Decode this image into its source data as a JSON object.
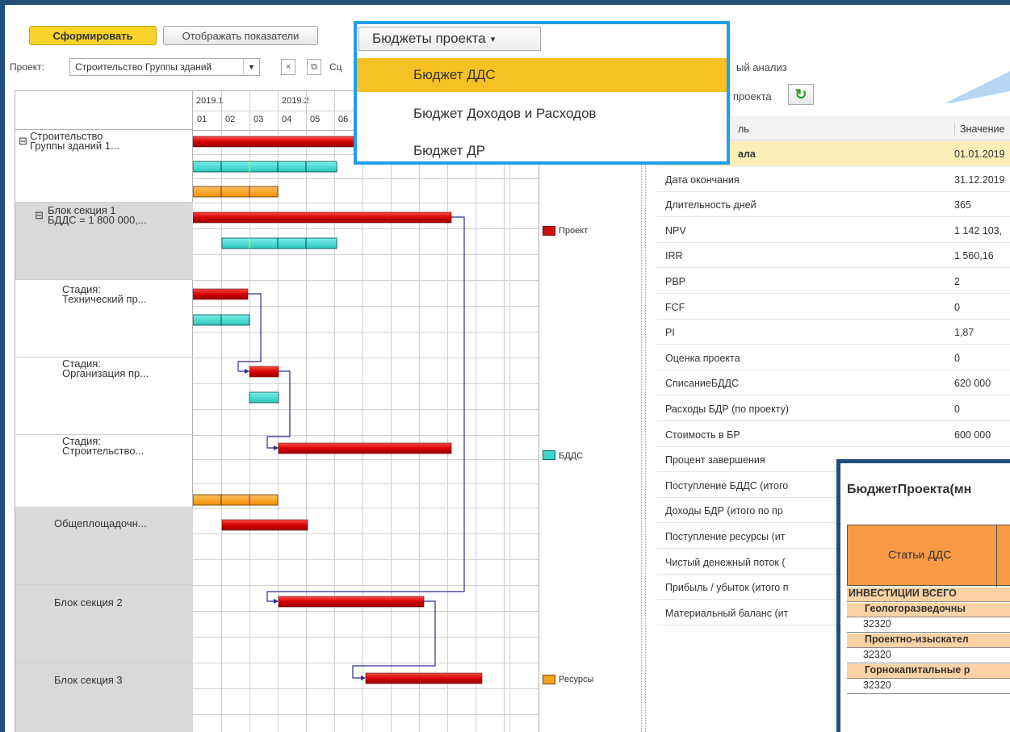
{
  "toolbar": {
    "form_label": "Сформировать",
    "show_label": "Отображать показатели"
  },
  "filter": {
    "project_label": "Проект:",
    "project_value": "Строительство Группы зданий",
    "clear_symbol": "×",
    "open_symbol": "⧉",
    "extra_label": "Сц"
  },
  "dropdown": {
    "title": "Бюджеты проекта",
    "items": [
      "Бюджет ДДС",
      "Бюджет Доходов и Расходов",
      "Бюджет ДР"
    ],
    "selected_index": 0
  },
  "gantt": {
    "periods": [
      {
        "label": "2019.1"
      },
      {
        "label": "2019.2"
      }
    ],
    "months": [
      "01",
      "02",
      "03",
      "04",
      "05",
      "06"
    ],
    "rows": [
      {
        "text": "Строительство\nГруппы зданий 1...",
        "toggle": "⊟"
      },
      {
        "text": "Блок секция 1\nБДДС = 1 800 000,...",
        "toggle": "⊟"
      },
      {
        "text": "Стадия:\nТехнический пр..."
      },
      {
        "text": "Стадия:\nОрганизация пр..."
      },
      {
        "text": "Стадия:\nСтроительство..."
      },
      {
        "text": "Общеплощадочн..."
      },
      {
        "text": "Блок секция 2"
      },
      {
        "text": "Блок секция 3"
      }
    ],
    "legend": [
      {
        "label": "Проект",
        "color": "#cc1111"
      },
      {
        "label": "БДДС",
        "color": "#3dd6cf"
      },
      {
        "label": "Ресурсы",
        "color": "#f5a31a"
      }
    ]
  },
  "right_panel": {
    "analysis_label": "ый анализ",
    "project_caption": "проекта",
    "refresh_icon": "refresh-icon",
    "col_name": "ль",
    "col_value": "Значение",
    "rows": [
      {
        "name": "ала",
        "value": "01.01.2019"
      },
      {
        "name": "Дата окончания",
        "value": "31.12.2019"
      },
      {
        "name": "Длительность дней",
        "value": "365"
      },
      {
        "name": "NPV",
        "value": "1 142 103,"
      },
      {
        "name": "IRR",
        "value": "1 560,16"
      },
      {
        "name": "PBP",
        "value": "2"
      },
      {
        "name": "FCF",
        "value": "0"
      },
      {
        "name": "PI",
        "value": "1,87"
      },
      {
        "name": "Оценка проекта",
        "value": "0"
      },
      {
        "name": "СписаниеБДДС",
        "value": "620 000"
      },
      {
        "name": "Расходы БДР (по проекту)",
        "value": "0"
      },
      {
        "name": "Стоимость в БР",
        "value": "600 000"
      },
      {
        "name": "Процент завершения",
        "value": ""
      },
      {
        "name": "Поступление БДДС (итого",
        "value": ""
      },
      {
        "name": "Доходы БДР (итого по пр",
        "value": ""
      },
      {
        "name": "Поступление ресурсы (ит",
        "value": ""
      },
      {
        "name": "Чистый денежный поток (",
        "value": ""
      },
      {
        "name": "Прибыль / убыток (итого п",
        "value": ""
      },
      {
        "name": "Материальный баланс (ит",
        "value": ""
      }
    ]
  },
  "budget": {
    "title": "БюджетПроекта(мн",
    "header": "Статьи ДДС",
    "rows": [
      {
        "text": "ИНВЕСТИЦИИ ВСЕГО",
        "style": "o"
      },
      {
        "text": "Геологоразведочны",
        "style": "o"
      },
      {
        "text": "32320",
        "style": "w"
      },
      {
        "text": "Проектно-изыскател",
        "style": "o"
      },
      {
        "text": "32320",
        "style": "w"
      },
      {
        "text": "Горнокапитальные р",
        "style": "o"
      },
      {
        "text": "32320",
        "style": "w"
      }
    ]
  }
}
